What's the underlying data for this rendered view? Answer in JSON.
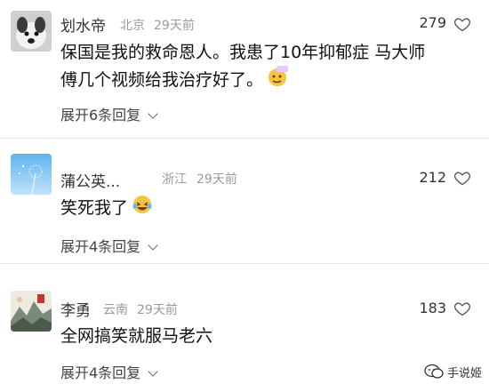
{
  "comments": [
    {
      "username": "划水帝",
      "location": "北京",
      "time": "29天前",
      "likes": "279",
      "text_lines": [
        "保国是我的救命恩人。我患了10年抑郁症 马大师",
        "傅几个视频给我治疗好了。"
      ],
      "emoji": "666-face-emoji",
      "expand": "展开6条回复"
    },
    {
      "username": "蒲公英...",
      "location": "浙江",
      "time": "29天前",
      "likes": "212",
      "text_lines": [
        "笑死我了"
      ],
      "emoji": "laughing-crying-emoji",
      "expand": "展开4条回复"
    },
    {
      "username": "李勇",
      "location": "云南",
      "time": "29天前",
      "likes": "183",
      "text_lines": [
        "全网搞笑就服马老六"
      ],
      "emoji": "",
      "expand": "展开4条回复"
    }
  ],
  "watermark": "手说姬",
  "colors": {
    "meta": "#9a9a9a",
    "divider": "#e8e8e8",
    "text": "#111111"
  }
}
